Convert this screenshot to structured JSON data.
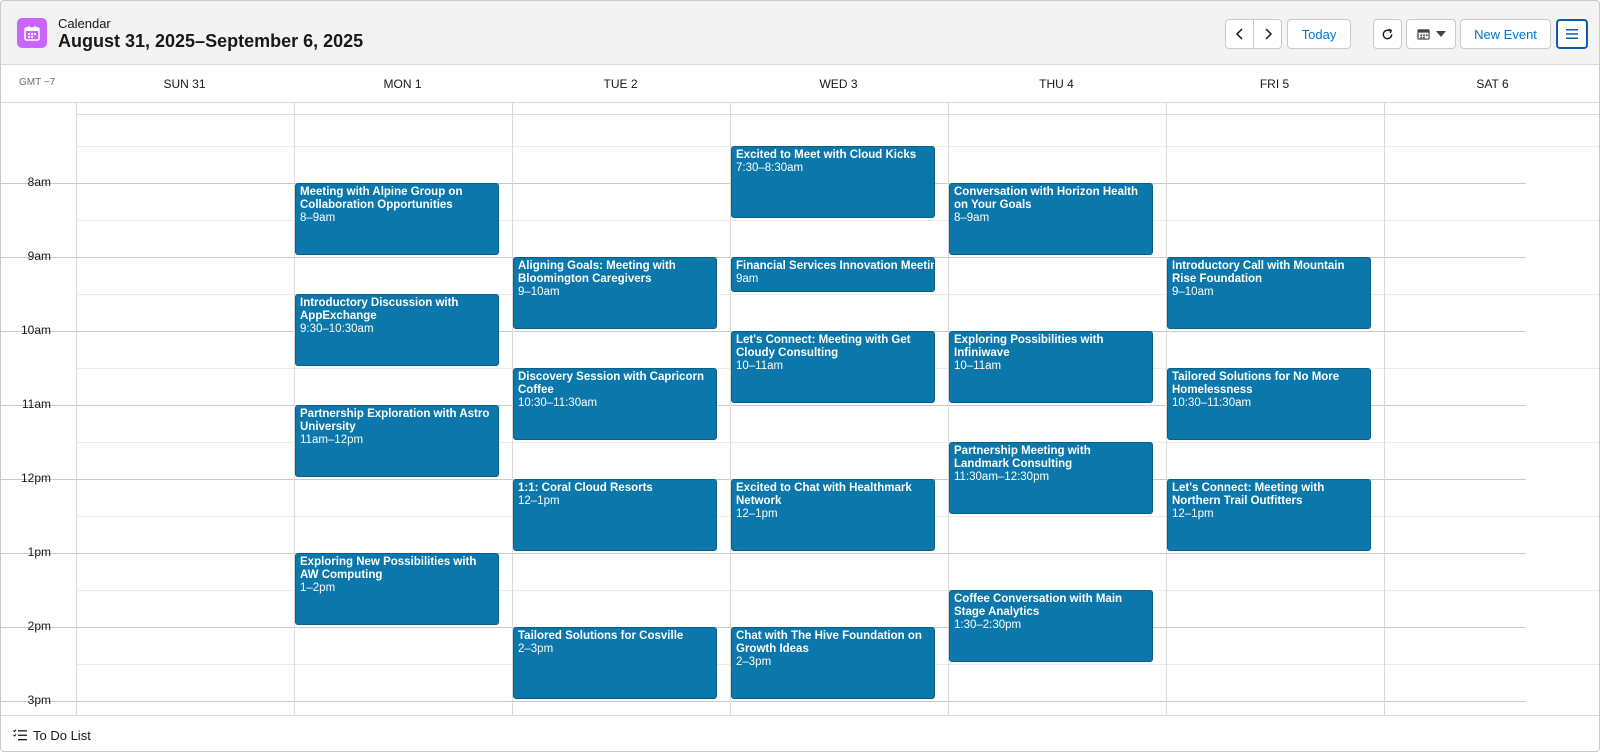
{
  "header": {
    "app_name": "Calendar",
    "range_title": "August 31, 2025–September 6, 2025",
    "today_label": "Today",
    "new_event_label": "New Event",
    "prev_icon": "chevron-left-icon",
    "next_icon": "chevron-right-icon",
    "refresh_icon": "refresh-icon",
    "view_icon": "calendar-view-icon",
    "menu_icon": "hamburger-menu-icon",
    "app_icon_color": "#cb65ff"
  },
  "timezone": "GMT −7",
  "days": [
    "SUN 31",
    "MON 1",
    "TUE 2",
    "WED 3",
    "THU 4",
    "FRI 5",
    "SAT 6"
  ],
  "hours": [
    "8am",
    "9am",
    "10am",
    "11am",
    "12pm",
    "1pm",
    "2pm",
    "3pm"
  ],
  "event_color": "#0c77aa",
  "events": [
    {
      "day": 1,
      "start": 8,
      "end": 9,
      "title": "Meeting with Alpine Group on Collaboration Opportunities",
      "time": "8–9am"
    },
    {
      "day": 1,
      "start": 9.5,
      "end": 10.5,
      "title": "Introductory Discussion with AppExchange",
      "time": "9:30–10:30am"
    },
    {
      "day": 1,
      "start": 11,
      "end": 12,
      "title": "Partnership Exploration with Astro University",
      "time": "11am–12pm"
    },
    {
      "day": 1,
      "start": 13,
      "end": 14,
      "title": "Exploring New Possibilities with AW Computing",
      "time": "1–2pm"
    },
    {
      "day": 2,
      "start": 9,
      "end": 10,
      "title": "Aligning Goals: Meeting with Bloomington Caregivers",
      "time": "9–10am"
    },
    {
      "day": 2,
      "start": 10.5,
      "end": 11.5,
      "title": "Discovery Session with Capricorn Coffee",
      "time": "10:30–11:30am"
    },
    {
      "day": 2,
      "start": 12,
      "end": 13,
      "title": "1:1: Coral Cloud Resorts",
      "time": "12–1pm"
    },
    {
      "day": 2,
      "start": 14,
      "end": 15,
      "title": "Tailored Solutions for Cosville",
      "time": "2–3pm"
    },
    {
      "day": 3,
      "start": 7.5,
      "end": 8.5,
      "title": "Excited to Meet with Cloud Kicks",
      "time": "7:30–8:30am"
    },
    {
      "day": 3,
      "start": 9,
      "end": 9.5,
      "title": "Financial Services Innovation Meeting",
      "time": "9am",
      "nowrap": true
    },
    {
      "day": 3,
      "start": 10,
      "end": 11,
      "title": "Let's Connect: Meeting with Get Cloudy Consulting",
      "time": "10–11am"
    },
    {
      "day": 3,
      "start": 12,
      "end": 13,
      "title": "Excited to Chat with Healthmark Network",
      "time": "12–1pm"
    },
    {
      "day": 3,
      "start": 14,
      "end": 15,
      "title": "Chat with The Hive Foundation on Growth Ideas",
      "time": "2–3pm"
    },
    {
      "day": 4,
      "start": 8,
      "end": 9,
      "title": "Conversation with Horizon Health on Your Goals",
      "time": "8–9am"
    },
    {
      "day": 4,
      "start": 10,
      "end": 11,
      "title": "Exploring Possibilities with Infiniwave",
      "time": "10–11am"
    },
    {
      "day": 4,
      "start": 11.5,
      "end": 12.5,
      "title": "Partnership Meeting with Landmark Consulting",
      "time": "11:30am–12:30pm"
    },
    {
      "day": 4,
      "start": 13.5,
      "end": 14.5,
      "title": "Coffee Conversation with Main Stage Analytics",
      "time": "1:30–2:30pm"
    },
    {
      "day": 5,
      "start": 9,
      "end": 10,
      "title": "Introductory Call with Mountain Rise Foundation",
      "time": "9–10am"
    },
    {
      "day": 5,
      "start": 10.5,
      "end": 11.5,
      "title": "Tailored Solutions for No More Homelessness",
      "time": "10:30–11:30am"
    },
    {
      "day": 5,
      "start": 12,
      "end": 13,
      "title": "Let's Connect: Meeting with Northern Trail Outfitters",
      "time": "12–1pm"
    }
  ],
  "footer": {
    "todo_label": "To Do List",
    "todo_icon": "checklist-icon"
  }
}
